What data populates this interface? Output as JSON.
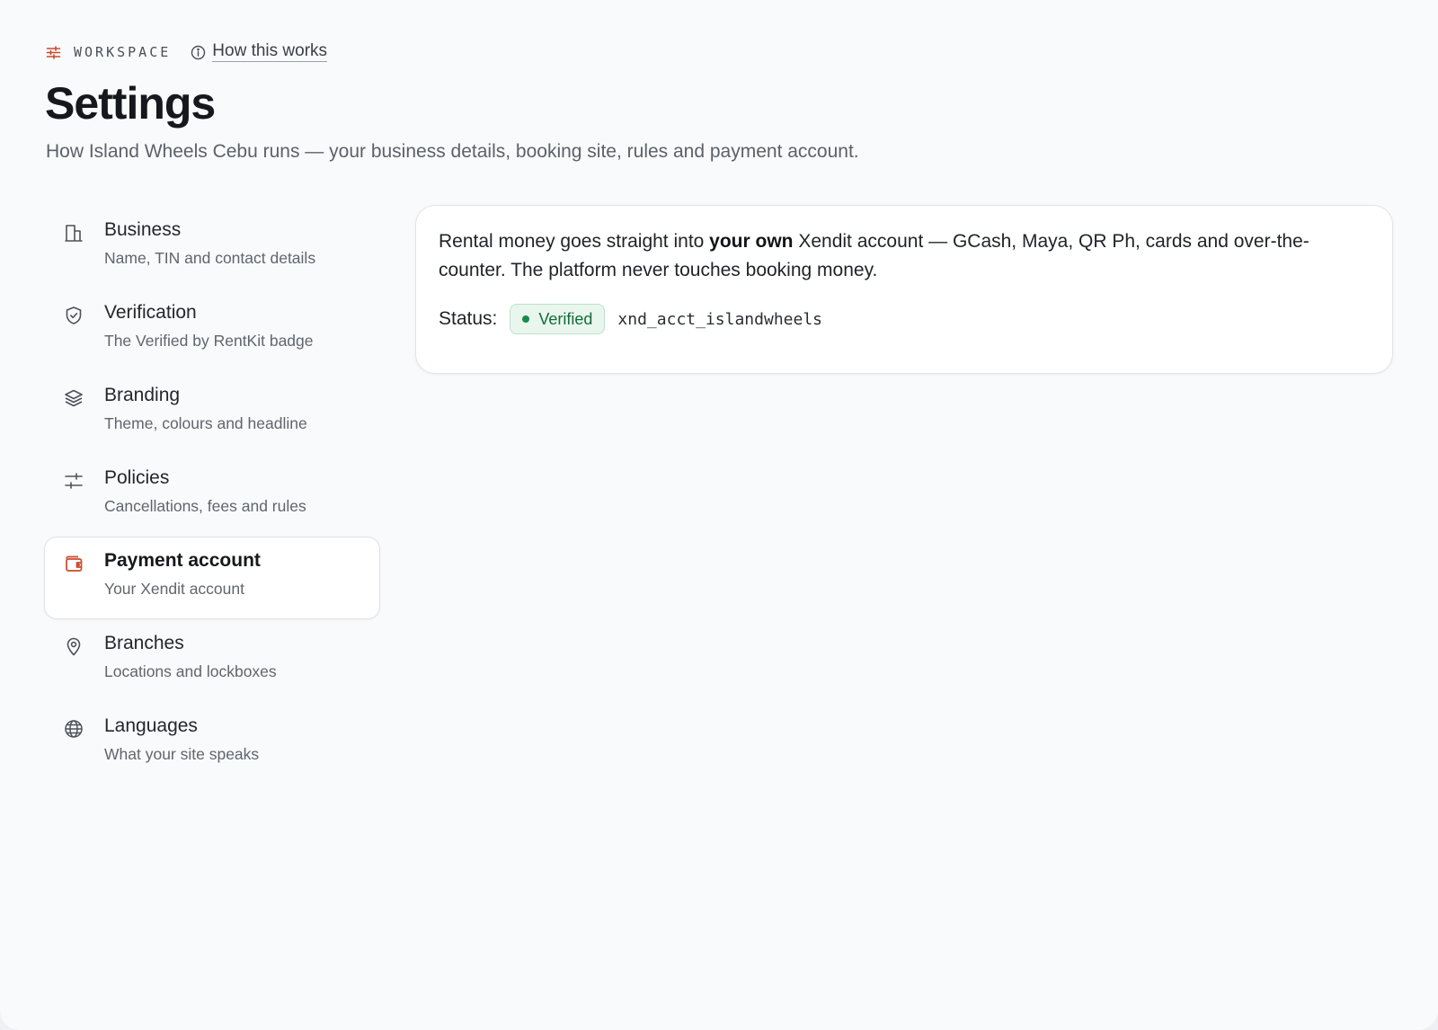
{
  "header": {
    "eyebrow": "WORKSPACE",
    "eyebrow_icon": "sliders-icon",
    "how_link": "How this works",
    "how_icon": "info-icon",
    "title": "Settings",
    "subtitle": "How Island Wheels Cebu runs — your business details, booking site, rules and payment account."
  },
  "nav": {
    "active_index": 4,
    "items": [
      {
        "label": "Business",
        "desc": "Name, TIN and contact details",
        "icon": "building-icon"
      },
      {
        "label": "Verification",
        "desc": "The Verified by RentKit badge",
        "icon": "shield-check-icon"
      },
      {
        "label": "Branding",
        "desc": "Theme, colours and headline",
        "icon": "layers-icon"
      },
      {
        "label": "Policies",
        "desc": "Cancellations, fees and rules",
        "icon": "sliders-icon"
      },
      {
        "label": "Payment account",
        "desc": "Your Xendit account",
        "icon": "wallet-icon"
      },
      {
        "label": "Branches",
        "desc": "Locations and lockboxes",
        "icon": "map-pin-icon"
      },
      {
        "label": "Languages",
        "desc": "What your site speaks",
        "icon": "globe-icon"
      }
    ]
  },
  "payment": {
    "desc_before": "Rental money goes straight into ",
    "desc_bold": "your own",
    "desc_after": " Xendit account — GCash, Maya, QR Ph, cards and over-the-counter. The platform never touches booking money.",
    "status_label": "Status:",
    "status_badge": "Verified",
    "account_id": "xnd_acct_islandwheels"
  },
  "colors": {
    "accent": "#c94a2a",
    "verified_bg": "#e9f6ee",
    "verified_text": "#146b3a",
    "background": "#f9fafb"
  }
}
